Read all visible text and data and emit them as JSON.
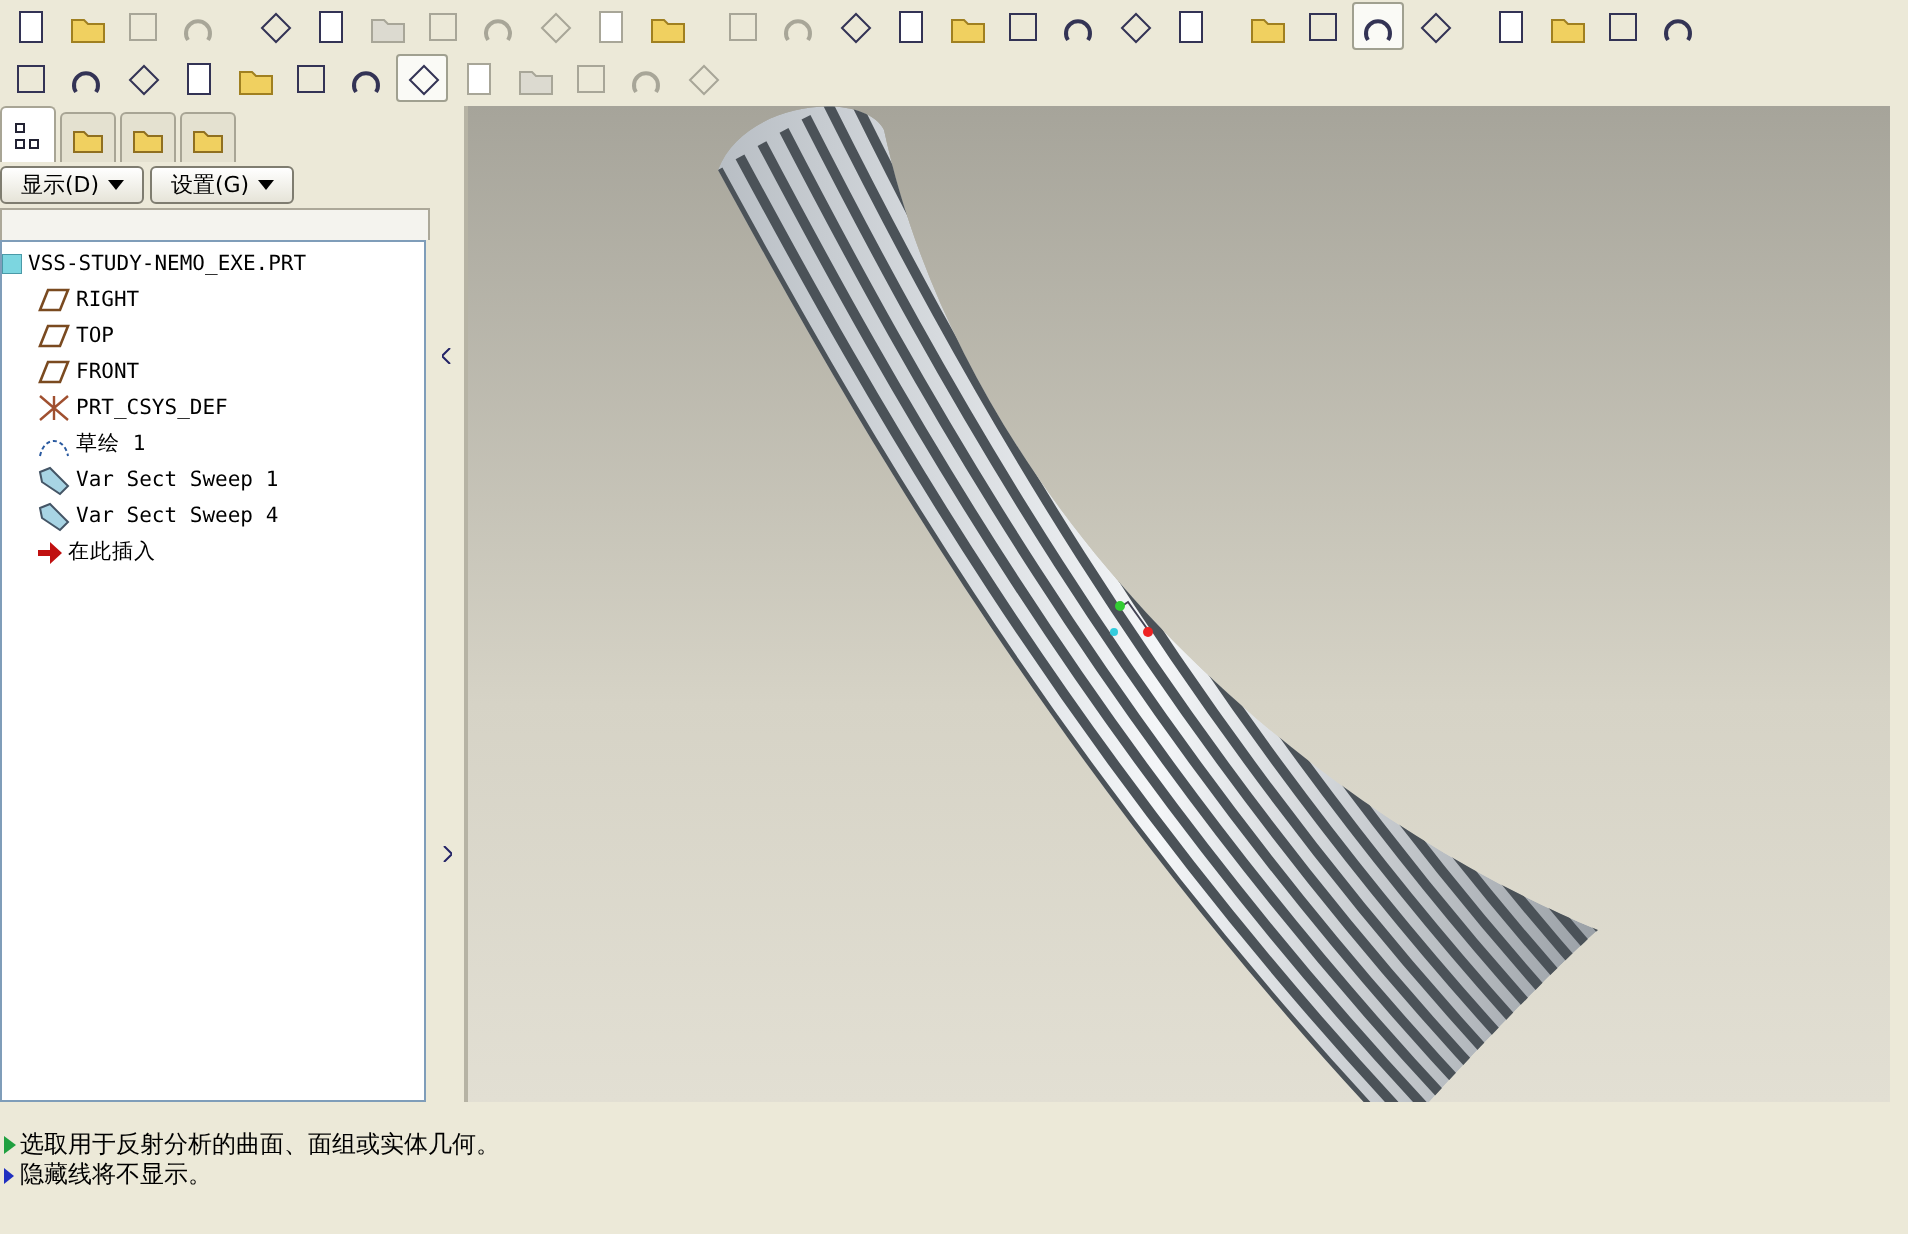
{
  "toolbar_rows": [
    [
      {
        "selected": false,
        "disabled": false
      },
      {
        "selected": false,
        "disabled": false
      },
      {
        "selected": false,
        "disabled": true
      },
      {
        "selected": false,
        "disabled": true
      },
      {
        "selected": false,
        "disabled": false
      },
      {
        "selected": false,
        "disabled": false
      },
      {
        "selected": false,
        "disabled": true
      },
      {
        "selected": false,
        "disabled": true
      },
      {
        "selected": false,
        "disabled": true
      },
      {
        "selected": false,
        "disabled": true
      },
      {
        "selected": false,
        "disabled": true
      },
      {
        "selected": false,
        "disabled": false
      },
      {
        "selected": false,
        "disabled": true
      },
      {
        "selected": false,
        "disabled": true
      },
      {
        "selected": false,
        "disabled": false
      },
      {
        "selected": false,
        "disabled": false
      },
      {
        "selected": false,
        "disabled": false
      },
      {
        "selected": false,
        "disabled": false
      },
      {
        "selected": false,
        "disabled": false
      },
      {
        "selected": false,
        "disabled": false
      },
      {
        "selected": false,
        "disabled": false
      },
      {
        "selected": false,
        "disabled": false
      },
      {
        "selected": false,
        "disabled": false
      },
      {
        "selected": true,
        "disabled": false
      },
      {
        "selected": false,
        "disabled": false
      },
      {
        "selected": false,
        "disabled": false
      },
      {
        "selected": false,
        "disabled": false
      },
      {
        "selected": false,
        "disabled": false
      },
      {
        "selected": false,
        "disabled": false
      }
    ],
    [
      {
        "selected": false,
        "disabled": false
      },
      {
        "selected": false,
        "disabled": false
      },
      {
        "selected": false,
        "disabled": false
      },
      {
        "selected": false,
        "disabled": false
      },
      {
        "selected": false,
        "disabled": false
      },
      {
        "selected": false,
        "disabled": false
      },
      {
        "selected": false,
        "disabled": false
      },
      {
        "selected": true,
        "disabled": false
      },
      {
        "selected": false,
        "disabled": true
      },
      {
        "selected": false,
        "disabled": true
      },
      {
        "selected": false,
        "disabled": true
      },
      {
        "selected": false,
        "disabled": true
      },
      {
        "selected": false,
        "disabled": true
      }
    ]
  ],
  "navigator": {
    "tabs": [
      {
        "selected": true
      },
      {
        "selected": false
      },
      {
        "selected": false
      },
      {
        "selected": false
      }
    ],
    "buttons": [
      "显示(D)",
      "设置(G)"
    ],
    "tree": {
      "label": "VSS-STUDY-NEMO_EXE.PRT",
      "children": [
        {
          "label": "RIGHT",
          "kind": "plane"
        },
        {
          "label": "TOP",
          "kind": "plane"
        },
        {
          "label": "FRONT",
          "kind": "plane"
        },
        {
          "label": "PRT_CSYS_DEF",
          "kind": "csys"
        },
        {
          "label": "草绘 1",
          "kind": "sketch"
        },
        {
          "label": "Var Sect Sweep 1",
          "kind": "sweep"
        },
        {
          "label": "Var Sect Sweep 4",
          "kind": "sweep"
        },
        {
          "label": "在此插入",
          "kind": "insert"
        }
      ]
    }
  },
  "messages": [
    {
      "text": "选取用于反射分析的曲面、面组或实体几何。",
      "kind": "prompt"
    },
    {
      "text": "隐藏线将不显示。",
      "kind": "info"
    }
  ]
}
